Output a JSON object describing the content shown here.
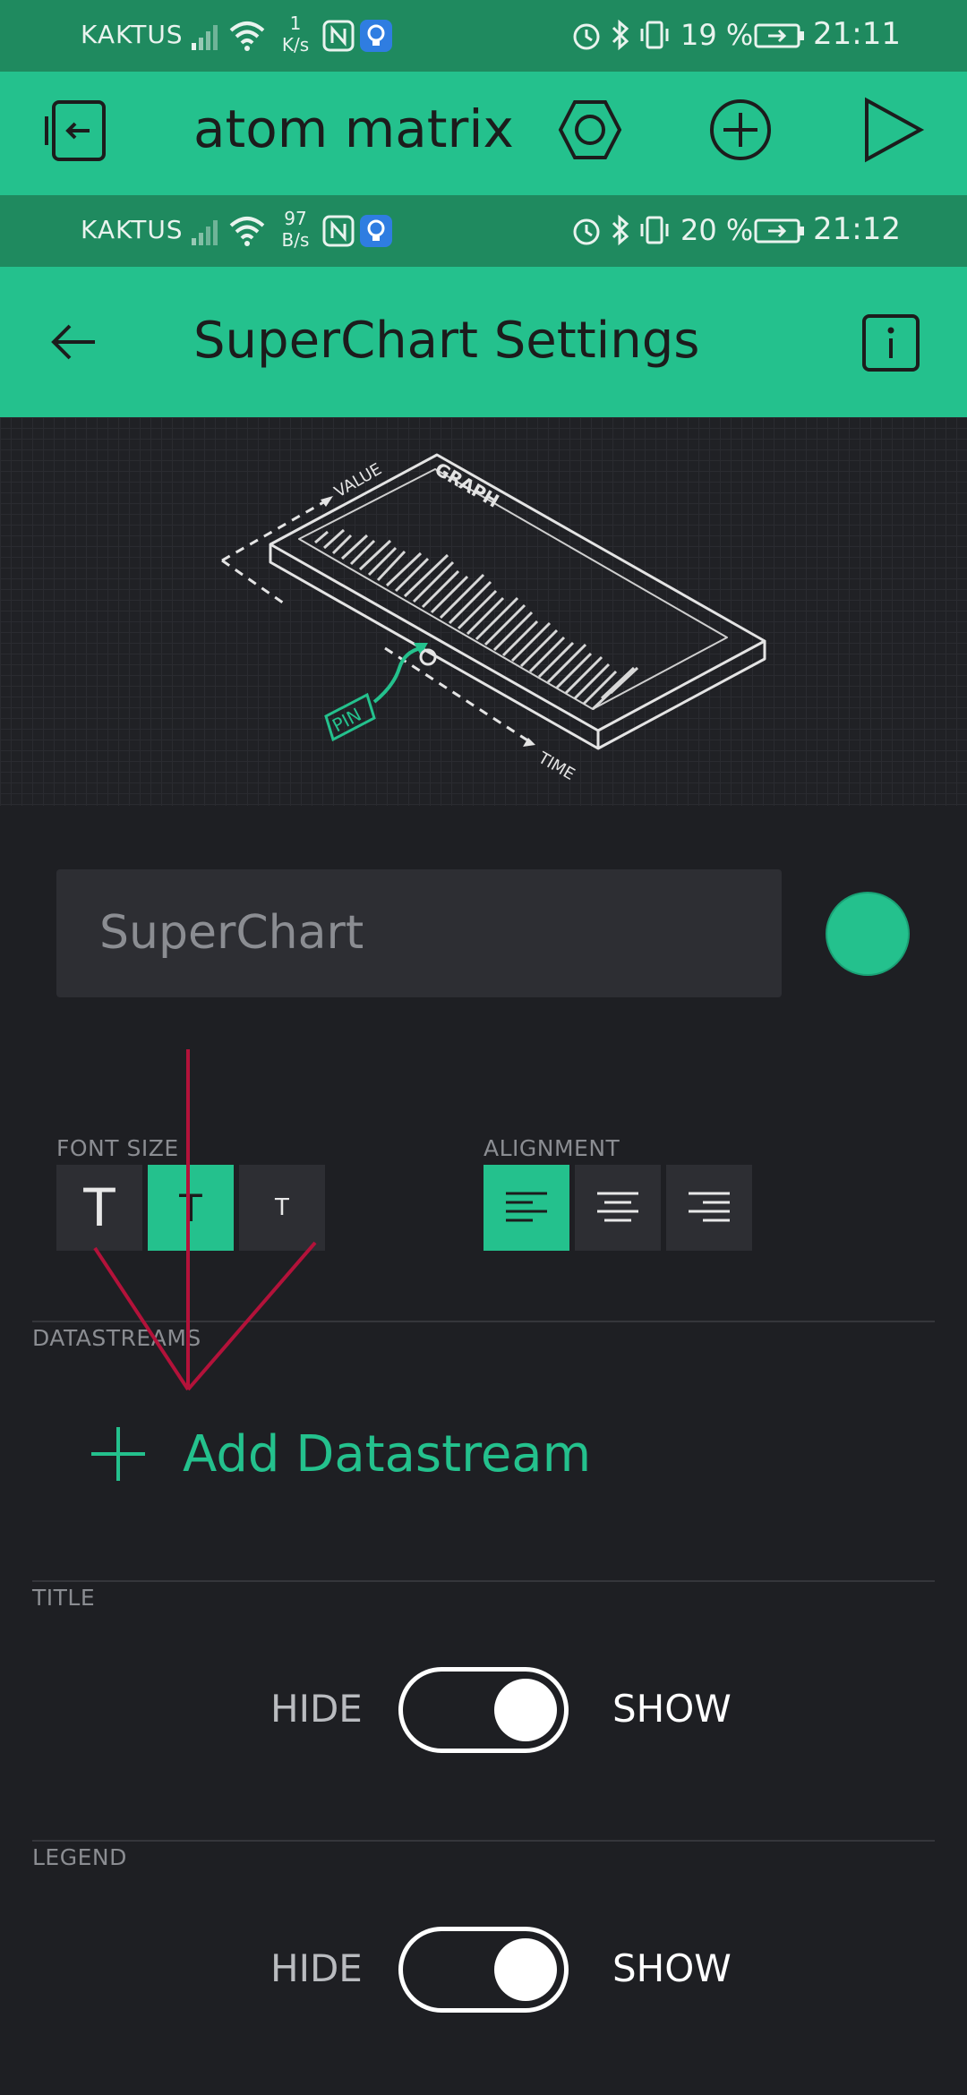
{
  "status_bar_top": {
    "carrier": "KAKTUS",
    "speed_value": "1",
    "speed_unit": "K/s",
    "battery": "19 %",
    "time": "21:11"
  },
  "app_bar_top": {
    "title": "atom matrix",
    "icons": [
      "device-back-icon",
      "hexagon-icon",
      "add-circle-icon",
      "play-icon"
    ]
  },
  "status_bar_bottom": {
    "carrier": "KAKTUS",
    "speed_value": "97",
    "speed_unit": "B/s",
    "battery": "20 %",
    "time": "21:12"
  },
  "app_bar_settings": {
    "title": "SuperChart Settings",
    "icons": [
      "back-arrow-icon",
      "info-icon"
    ]
  },
  "illustration": {
    "labels": {
      "value": "VALUE",
      "graph": "GRAPH",
      "pin": "PIN",
      "time": "TIME"
    }
  },
  "widget_name": {
    "placeholder": "SuperChart"
  },
  "colors": {
    "accent": "#24c18d",
    "status": "#1f8a5f",
    "background": "#1e1f23",
    "field": "#2d2e33",
    "annotation": "#b3123a"
  },
  "font_size": {
    "label": "FONT SIZE",
    "options": [
      "T",
      "T",
      "T"
    ],
    "selected_index": 1
  },
  "alignment": {
    "label": "ALIGNMENT",
    "options": [
      "left",
      "center",
      "right"
    ],
    "selected_index": 0
  },
  "datastreams": {
    "label": "DATASTREAMS",
    "add_label": "Add Datastream"
  },
  "title_section": {
    "label": "TITLE",
    "hide": "HIDE",
    "show": "SHOW",
    "value": "show"
  },
  "legend_section": {
    "label": "LEGEND",
    "hide": "HIDE",
    "show": "SHOW",
    "value": "show"
  }
}
